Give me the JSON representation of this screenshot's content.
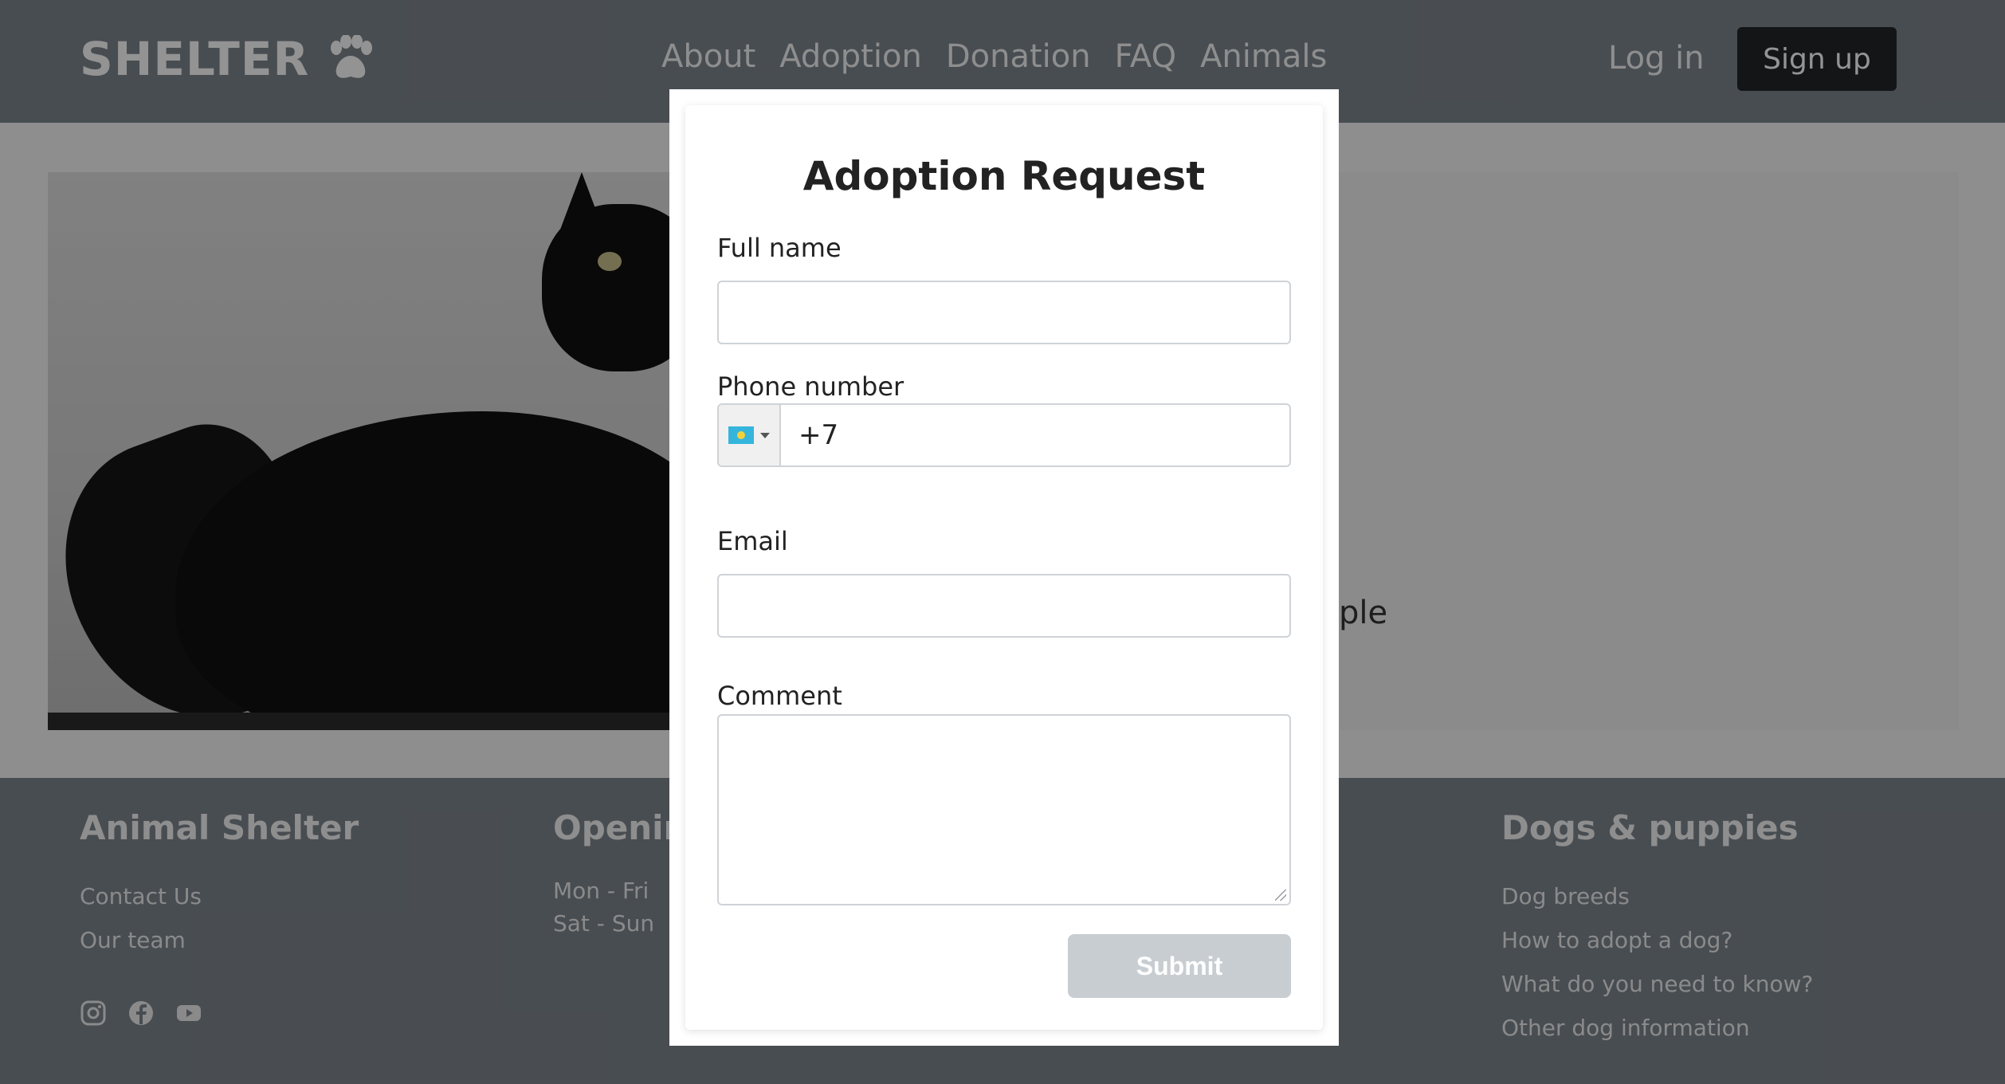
{
  "header": {
    "logo_text": "SHELTER",
    "logo_icon": "paw-icon",
    "nav": [
      "About",
      "Adoption",
      "Donation",
      "FAQ",
      "Animals"
    ],
    "login_label": "Log in",
    "signup_label": "Sign up"
  },
  "hero": {
    "photo": "black-cat-photo",
    "visible_text": "ple"
  },
  "footer": {
    "col1": {
      "title": "Animal Shelter",
      "links": [
        "Contact Us",
        "Our team"
      ]
    },
    "col2": {
      "title": "Openin",
      "rows": [
        "Mon - Fri",
        "Sat - Sun"
      ]
    },
    "col4": {
      "title": "Dogs & puppies",
      "links": [
        "Dog breeds",
        "How to adopt a dog?",
        "What do you need to know?",
        "Other dog information"
      ]
    },
    "socials": [
      "instagram-icon",
      "facebook-icon",
      "youtube-icon"
    ]
  },
  "modal": {
    "title": "Adoption Request",
    "full_name": {
      "label": "Full name",
      "value": "",
      "placeholder": ""
    },
    "phone": {
      "label": "Phone number",
      "country_flag": "kazakhstan-flag-icon",
      "value": "+7"
    },
    "email": {
      "label": "Email",
      "value": "",
      "placeholder": ""
    },
    "comment": {
      "label": "Comment",
      "value": ""
    },
    "submit_label": "Submit"
  },
  "colors": {
    "header_bg": "#7d858d",
    "signup_bg": "#212529",
    "overlay": "rgba(0,0,0,0.42)",
    "submit_disabled": "#c8cdd1"
  }
}
